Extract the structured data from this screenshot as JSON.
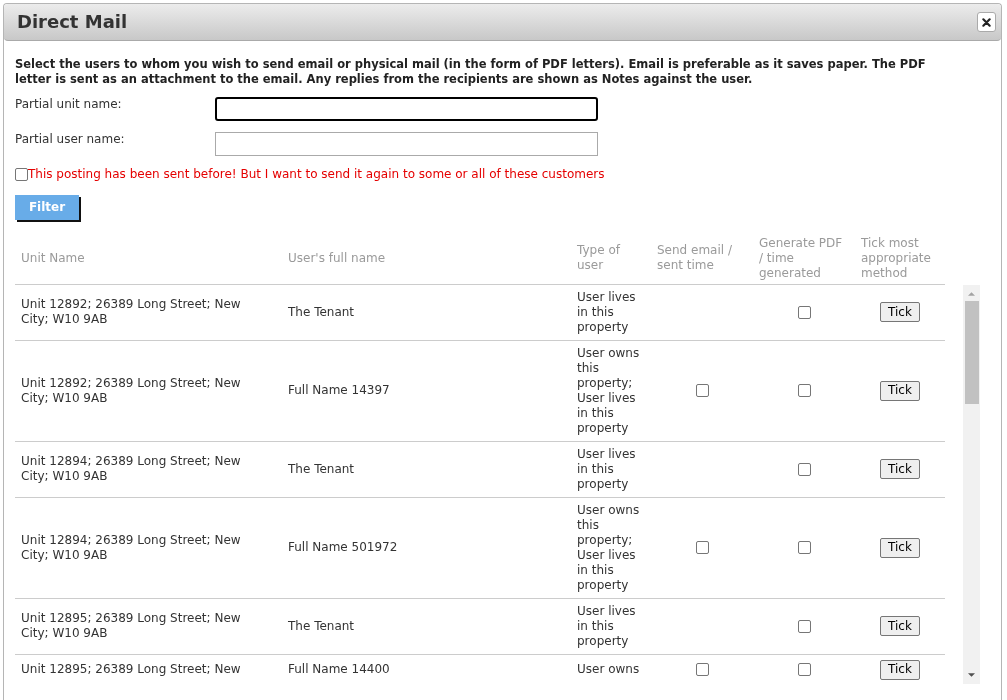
{
  "dialog": {
    "title": "Direct Mail"
  },
  "description": "Select the users to whom you wish to send email or physical mail (in the form of PDF letters). Email is preferable as it saves paper. The PDF letter is sent as an attachment to the email. Any replies from the recipients are shown as Notes against the user.",
  "fields": [
    {
      "label": "Partial unit name:",
      "focused": true
    },
    {
      "label": "Partial user name:",
      "focused": false
    }
  ],
  "resend_option": {
    "label": "This posting has been sent before! But I want to send it again to some or all of these customers",
    "checked": false
  },
  "filter_button": "Filter",
  "table": {
    "columns": [
      "Unit Name",
      "User's full name",
      "Type of user",
      "Send email / sent time",
      "Generate PDF / time generated",
      "Tick most appropriate method"
    ],
    "rows": [
      {
        "unit_name": "Unit 12892; 26389 Long Street; New City; W10 9AB",
        "full_name": "The Tenant",
        "user_type": "User lives in this property",
        "generate_pdf": {
          "checked": false
        },
        "action": "Tick"
      },
      {
        "unit_name": "Unit 12892; 26389 Long Street; New City; W10 9AB",
        "full_name": "Full Name 14397",
        "user_type": "User owns this property; User lives in this property",
        "send_email": {
          "checked": false
        },
        "generate_pdf": {
          "checked": false
        },
        "action": "Tick"
      },
      {
        "unit_name": "Unit 12894; 26389 Long Street; New City; W10 9AB",
        "full_name": "The Tenant",
        "user_type": "User lives in this property",
        "generate_pdf": {
          "checked": false
        },
        "action": "Tick"
      },
      {
        "unit_name": "Unit 12894; 26389 Long Street; New City; W10 9AB",
        "full_name": "Full Name 501972",
        "user_type": "User owns this property; User lives in this property",
        "send_email": {
          "checked": false
        },
        "generate_pdf": {
          "checked": false
        },
        "action": "Tick"
      },
      {
        "unit_name": "Unit 12895; 26389 Long Street; New City; W10 9AB",
        "full_name": "The Tenant",
        "user_type": "User lives in this property",
        "generate_pdf": {
          "checked": false
        },
        "action": "Tick"
      },
      {
        "unit_name": "Unit 12895; 26389 Long Street; New",
        "full_name": "Full Name 14400",
        "user_type": "User owns",
        "send_email": {
          "checked": false
        },
        "generate_pdf": {
          "checked": false
        },
        "action": "Tick"
      }
    ]
  }
}
